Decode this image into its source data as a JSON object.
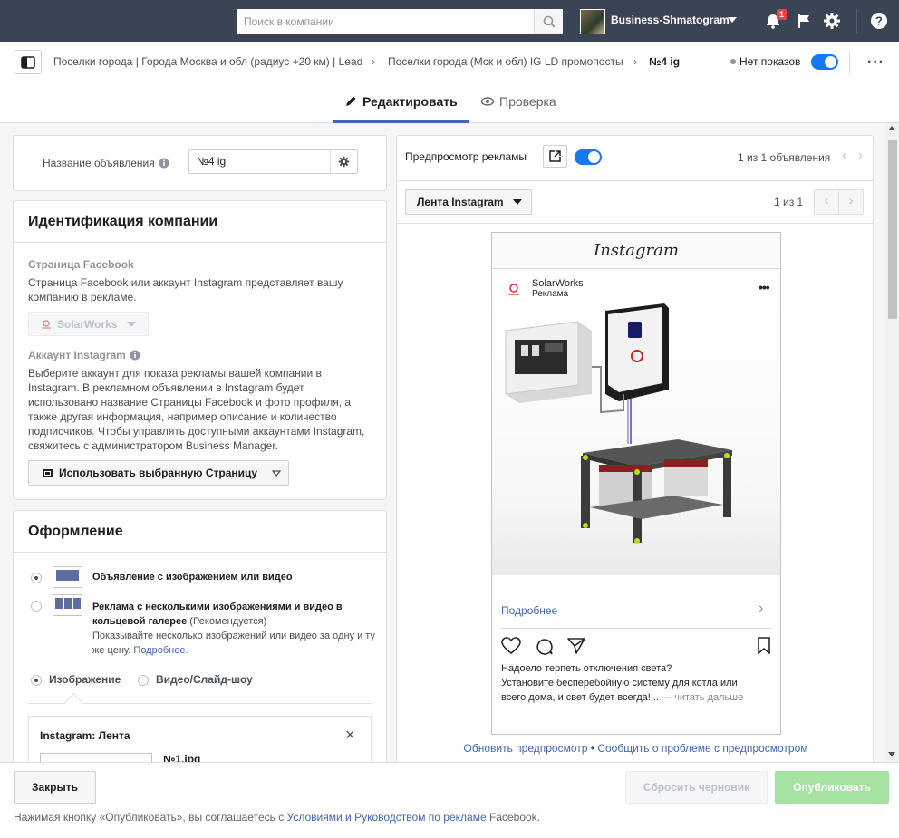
{
  "topbar": {
    "search_placeholder": "Поиск в компании",
    "business_name": "Business-Shmatogram",
    "notifications_count": "1"
  },
  "breadcrumb": {
    "items": [
      "Поселки города | Города Москва и обл (радиус +20 км) | Lead",
      "Поселки города (Мск и обл) IG LD промопосты",
      "№4 ig"
    ],
    "status": "Нет показов"
  },
  "tabs": {
    "edit": "Редактировать",
    "review": "Проверка"
  },
  "ad_name": {
    "label": "Название объявления",
    "value": "№4 ig"
  },
  "identity": {
    "title": "Идентификация компании",
    "fb_page_label": "Страница Facebook",
    "fb_page_desc": "Страница Facebook или аккаунт Instagram представляет вашу компанию в рекламе.",
    "fb_page_value": "SolarWorks",
    "ig_label": "Аккаунт Instagram",
    "ig_desc": "Выберите аккаунт для показа рекламы вашей компании в Instagram. В рекламном объявлении в Instagram будет использовано название Страницы Facebook и фото профиля, а также другая информация, например описание и количество подписчиков. Чтобы управлять доступными аккаунтами Instagram, свяжитесь с администратором Business Manager.",
    "ig_button": "Использовать выбранную Страницу"
  },
  "format": {
    "title": "Оформление",
    "opt1": "Объявление с изображением или видео",
    "opt2_bold": "Реклама с несколькими изображениями и видео в кольцевой галерее",
    "opt2_rec": "(Рекомендуется)",
    "opt2_desc": "Показывайте несколько изображений или видео за одну и ту же цену.",
    "opt2_more": "Подробнее.",
    "media_image": "Изображение",
    "media_video": "Видео/Слайд-шоу",
    "placement_title": "Instagram: Лента",
    "file_name": "№1.jpg"
  },
  "preview": {
    "title": "Предпросмотр рекламы",
    "count": "1 из 1 объявления",
    "placement": "Лента Instagram",
    "page": "1 из 1",
    "ig_logo": "Instagram",
    "account": "SolarWorks",
    "sponsored": "Реклама",
    "cta": "Подробнее",
    "caption_l1": "Надоело терпеть отключения света?",
    "caption_l2": "Установите бесперебойную систему для котла или",
    "caption_l3": "всего дома, и свет будет всегда!...",
    "read_more": "— читать дальше",
    "refresh": "Обновить предпросмотр",
    "report": "Сообщить о проблеме с предпросмотром",
    "dot": "•"
  },
  "footer": {
    "close": "Закрыть",
    "reset": "Сбросить черновик",
    "publish": "Опубликовать",
    "terms_pre": "Нажимая кнопку «Опубликовать», вы соглашаетесь с",
    "terms_link": "Условиями и Руководством по рекламе",
    "terms_post": "Facebook."
  },
  "colors": {
    "topbar": "#3b4454",
    "accent": "#4267b2",
    "toggle": "#1877f2",
    "publish": "#a6e3a1"
  }
}
